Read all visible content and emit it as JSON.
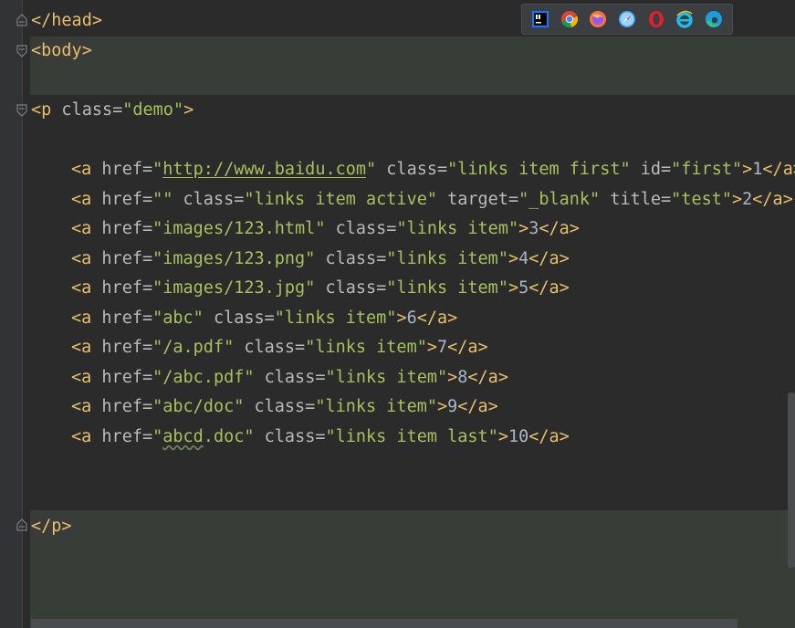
{
  "browsers": [
    {
      "name": "IntelliJ IDEA",
      "icon": "intellij-icon"
    },
    {
      "name": "Chrome",
      "icon": "chrome-icon"
    },
    {
      "name": "Firefox",
      "icon": "firefox-icon"
    },
    {
      "name": "Safari",
      "icon": "safari-icon"
    },
    {
      "name": "Opera",
      "icon": "opera-icon"
    },
    {
      "name": "Internet Explorer",
      "icon": "ie-icon"
    },
    {
      "name": "Edge",
      "icon": "edge-icon"
    }
  ],
  "code": {
    "head_close": "</head>",
    "body_open": "<body>",
    "p_open": {
      "open": "<p",
      "attr": " class=",
      "val": "\"demo\"",
      "close": ">"
    },
    "p_close": "</p>",
    "links": [
      {
        "href": "http://www.baidu.com",
        "rest": [
          {
            "a": " class=",
            "v": "\"links item first\""
          },
          {
            "a": " id=",
            "v": "\"first\""
          }
        ],
        "text": "1"
      },
      {
        "href": "",
        "rest": [
          {
            "a": " class=",
            "v": "\"links item active\""
          },
          {
            "a": " target=",
            "v": "\"_blank\""
          },
          {
            "a": " title=",
            "v": "\"test\""
          }
        ],
        "text": "2"
      },
      {
        "href": "images/123.html",
        "rest": [
          {
            "a": " class=",
            "v": "\"links item\""
          }
        ],
        "text": "3"
      },
      {
        "href": "images/123.png",
        "rest": [
          {
            "a": " class=",
            "v": "\"links item\""
          }
        ],
        "text": "4"
      },
      {
        "href": "images/123.jpg",
        "rest": [
          {
            "a": " class=",
            "v": "\"links item\""
          }
        ],
        "text": "5"
      },
      {
        "href": "abc",
        "rest": [
          {
            "a": " class=",
            "v": "\"links item\""
          }
        ],
        "text": "6"
      },
      {
        "href": "/a.pdf",
        "rest": [
          {
            "a": " class=",
            "v": "\"links item\""
          }
        ],
        "text": "7"
      },
      {
        "href": "/abc.pdf",
        "rest": [
          {
            "a": " class=",
            "v": "\"links item\""
          }
        ],
        "text": "8"
      },
      {
        "href": "abc/doc",
        "rest": [
          {
            "a": " class=",
            "v": "\"links item\""
          }
        ],
        "text": "9"
      },
      {
        "href": "abcd.doc",
        "rest": [
          {
            "a": " class=",
            "v": "\"links item last\""
          }
        ],
        "text": "10"
      }
    ]
  }
}
